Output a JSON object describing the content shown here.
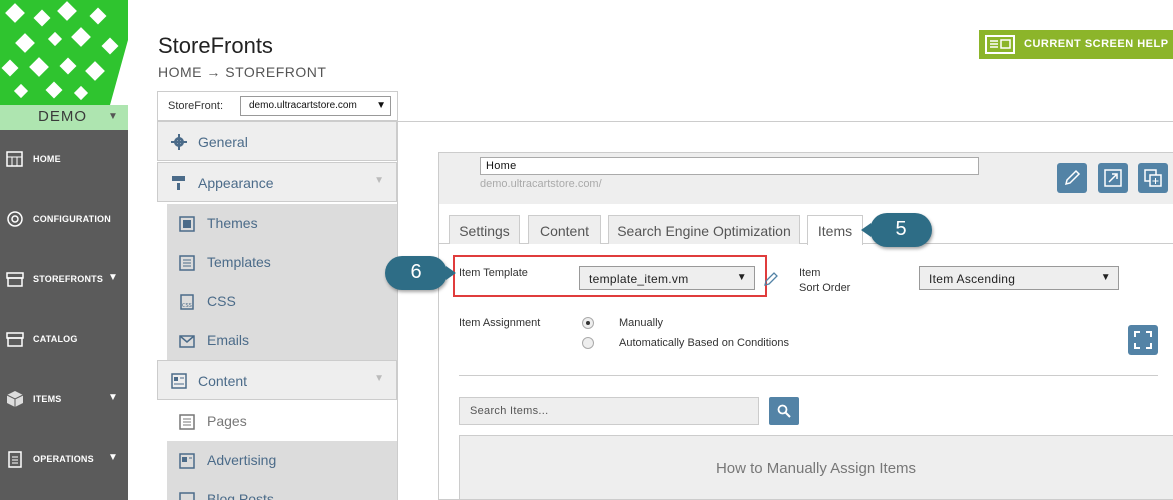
{
  "brand": {
    "demo_label": "DEMO"
  },
  "nav": {
    "items": [
      {
        "label": "HOME",
        "icon": "home-icon"
      },
      {
        "label": "CONFIGURATION",
        "icon": "gear-icon"
      },
      {
        "label": "STOREFRONTS",
        "icon": "storefront-icon"
      },
      {
        "label": "CATALOG",
        "icon": "catalog-icon"
      },
      {
        "label": "ITEMS",
        "icon": "box-icon"
      },
      {
        "label": "OPERATIONS",
        "icon": "clipboard-icon"
      }
    ]
  },
  "header": {
    "title": "StoreFronts",
    "breadcrumb": "HOME → STOREFRONT",
    "help_button": "CURRENT SCREEN HELP"
  },
  "storefront_selector": {
    "label": "StoreFront:",
    "value": "demo.ultracartstore.com"
  },
  "submenu": {
    "general": "General",
    "appearance": "Appearance",
    "themes": "Themes",
    "templates": "Templates",
    "css": "CSS",
    "emails": "Emails",
    "content": "Content",
    "pages": "Pages",
    "advertising": "Advertising",
    "blog_posts": "Blog Posts"
  },
  "page": {
    "name": "Home",
    "url": "demo.ultracartstore.com/"
  },
  "tabs": [
    "Settings",
    "Content",
    "Search Engine Optimization",
    "Items"
  ],
  "callouts": {
    "tab": "5",
    "template": "6"
  },
  "form": {
    "item_template_label": "Item Template",
    "item_template_value": "template_item.vm",
    "sort_label_1": "Item",
    "sort_label_2": "Sort Order",
    "sort_value": "Item Ascending",
    "assignment_label": "Item Assignment",
    "assignment_options": [
      "Manually",
      "Automatically Based on Conditions"
    ],
    "search_placeholder": "Search Items...",
    "howto_title": "How to Manually Assign Items"
  },
  "colors": {
    "nav_bg": "#5b5b5b",
    "accent_blue": "#5383a6",
    "callout": "#2e6d86",
    "help_green": "#8cb52a",
    "highlight_red": "#e03c3c"
  }
}
